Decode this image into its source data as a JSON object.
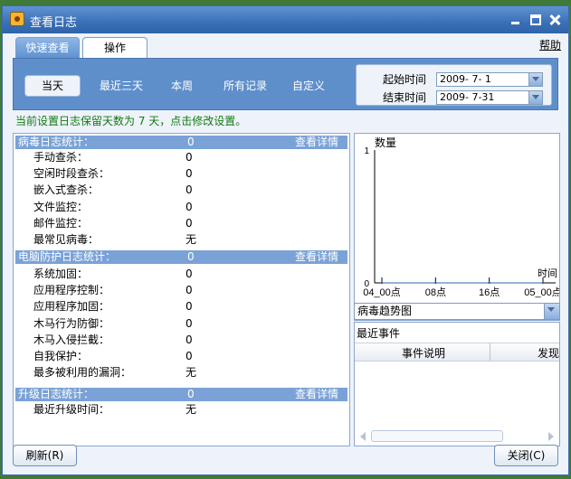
{
  "window": {
    "title": "查看日志"
  },
  "tabs": [
    {
      "label": "快速查看"
    },
    {
      "label": "操作"
    }
  ],
  "help": "帮助",
  "filters": [
    "当天",
    "最近三天",
    "本周",
    "所有记录",
    "自定义"
  ],
  "dates": {
    "start_label": "起始时间",
    "start_value": "2009- 7- 1",
    "end_label": "结束时间",
    "end_value": "2009- 7-31"
  },
  "notice": "当前设置日志保留天数为 7 天，点击修改设置。",
  "sections": {
    "virus": {
      "title": "病毒日志统计：",
      "value": "0",
      "link": "查看详情",
      "rows": [
        {
          "label": "手动查杀：",
          "value": "0"
        },
        {
          "label": "空闲时段查杀：",
          "value": "0"
        },
        {
          "label": "嵌入式查杀：",
          "value": "0"
        },
        {
          "label": "文件监控：",
          "value": "0"
        },
        {
          "label": "邮件监控：",
          "value": "0"
        },
        {
          "label": "最常见病毒：",
          "value": "无"
        }
      ]
    },
    "protection": {
      "title": "电脑防护日志统计：",
      "value": "0",
      "link": "查看详情",
      "rows": [
        {
          "label": "系统加固：",
          "value": "0"
        },
        {
          "label": "应用程序控制：",
          "value": "0"
        },
        {
          "label": "应用程序加固：",
          "value": "0"
        },
        {
          "label": "木马行为防御：",
          "value": "0"
        },
        {
          "label": "木马入侵拦截：",
          "value": "0"
        },
        {
          "label": "自我保护：",
          "value": "0"
        },
        {
          "label": "最多被利用的漏洞：",
          "value": "无"
        }
      ]
    },
    "upgrade": {
      "title": "升级日志统计：",
      "value": "0",
      "link": "查看详情",
      "rows": [
        {
          "label": "最近升级时间：",
          "value": "无"
        }
      ]
    }
  },
  "chart_data": {
    "type": "line",
    "ylabel": "数量",
    "xlabel": "时间",
    "ylim": [
      0,
      1
    ],
    "y_ticks": [
      "0",
      "1"
    ],
    "x_ticks": [
      "04_00点",
      "08点",
      "16点",
      "05_00点"
    ],
    "series": [
      {
        "values": [
          0,
          0,
          0,
          0
        ]
      }
    ]
  },
  "chart_select": "病毒趋势图",
  "events": {
    "title": "最近事件",
    "columns": [
      "事件说明",
      "发现"
    ]
  },
  "buttons": {
    "refresh": "刷新(R)",
    "close": "关闭(C)"
  },
  "colors": {
    "accent": "#5f8fcb",
    "notice": "#127a12",
    "header": "#7aa2d6"
  }
}
